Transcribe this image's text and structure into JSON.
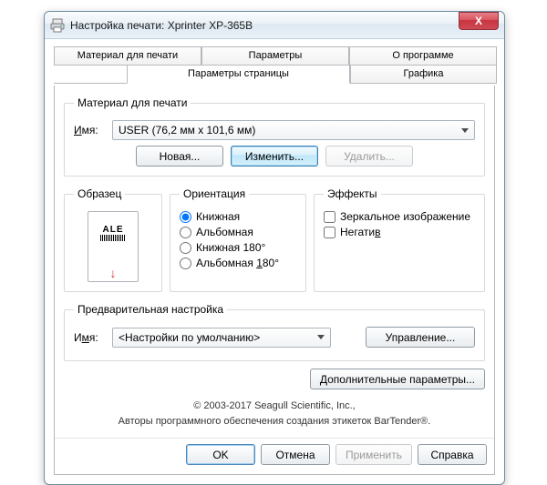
{
  "titlebar": {
    "title": "Настройка печати: Xprinter XP-365B",
    "close": "X"
  },
  "tabs": {
    "back": [
      "Материал для печати",
      "Параметры",
      "О программе"
    ],
    "front": [
      "Параметры страницы",
      "Графика"
    ]
  },
  "stock": {
    "legend": "Материал для печати",
    "name_label": "Имя:",
    "selected": "USER (76,2 мм x 101,6 мм)",
    "new_btn": "Новая...",
    "edit_btn": "Изменить...",
    "delete_btn": "Удалить..."
  },
  "sample": {
    "legend": "Образец",
    "text": "ALE"
  },
  "orientation": {
    "legend": "Ориентация",
    "options": [
      "Книжная",
      "Альбомная",
      "Книжная 180°",
      "Альбомная 180°"
    ],
    "selected_index": 0
  },
  "effects": {
    "legend": "Эффекты",
    "options": [
      "Зеркальное изображение",
      "Негатив"
    ]
  },
  "preset": {
    "legend": "Предварительная настройка",
    "name_label": "Имя:",
    "selected": "<Настройки по умолчанию>",
    "manage_btn": "Управление..."
  },
  "advanced_btn": "Дополнительные параметры...",
  "footer": {
    "line1": "© 2003-2017 Seagull Scientific, Inc.,",
    "line2": "Авторы программного обеспечения создания этикеток BarTender®."
  },
  "dlg": {
    "ok": "OK",
    "cancel": "Отмена",
    "apply": "Применить",
    "help": "Справка"
  }
}
